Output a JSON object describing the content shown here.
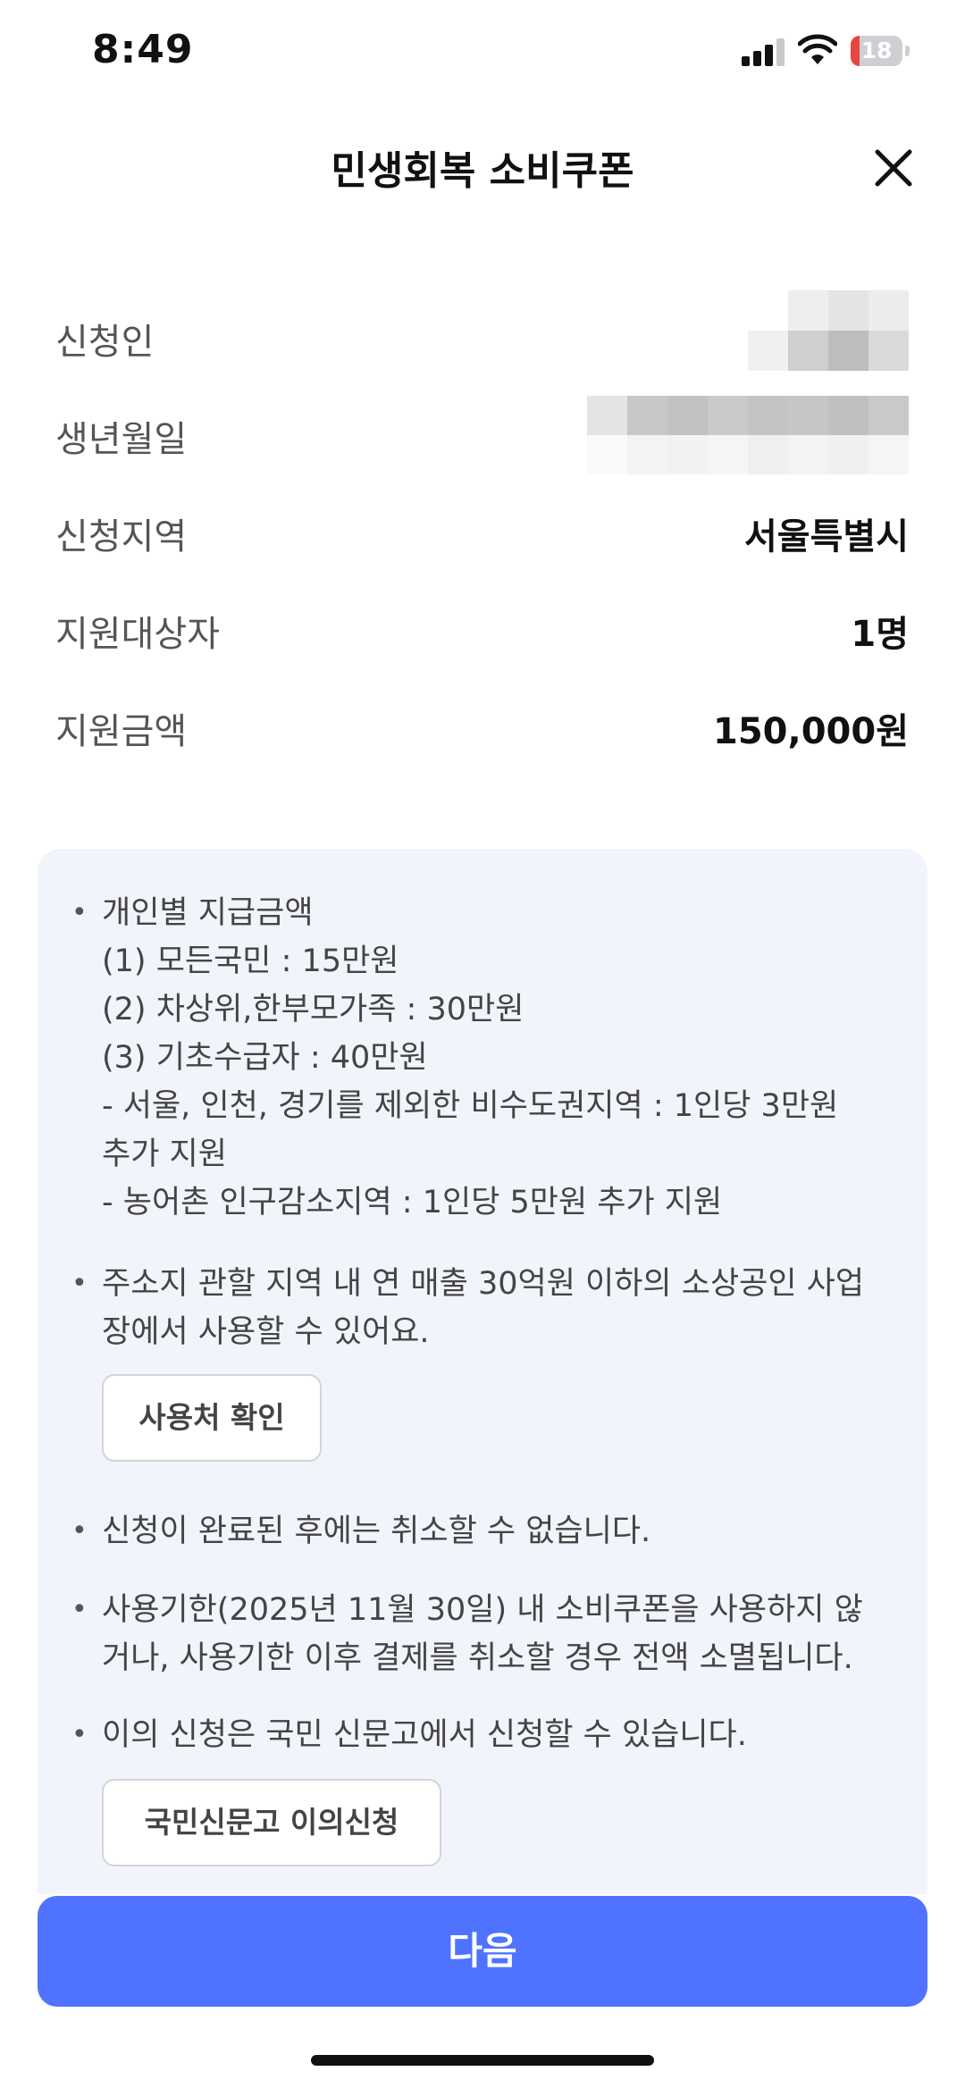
{
  "status_bar": {
    "time": "8:49",
    "battery_level": "18",
    "battery_fraction": 0.18,
    "battery_color": "#e5463f"
  },
  "header": {
    "title": "민생회복 소비쿠폰",
    "close_icon": "close-icon"
  },
  "info_rows": [
    {
      "label": "신청인",
      "value": null,
      "redacted": true
    },
    {
      "label": "생년월일",
      "value": null,
      "redacted": true
    },
    {
      "label": "신청지역",
      "value": "서울특별시"
    },
    {
      "label": "지원대상자",
      "value": "1명"
    },
    {
      "label": "지원금액",
      "value": "150,000원"
    }
  ],
  "notice": {
    "items": [
      {
        "lines": [
          "개인별 지급금액",
          "(1) 모든국민 : 15만원",
          "(2) 차상위,한부모가족 : 30만원",
          "(3) 기초수급자 : 40만원",
          "- 서울, 인천, 경기를 제외한 비수도권지역 : 1인당 3만원",
          "추가 지원",
          "- 농어촌 인구감소지역 : 1인당 5만원 추가 지원"
        ]
      },
      {
        "lines": [
          "주소지 관할 지역 내 연 매출 30억원 이하의 소상공인 사업",
          "장에서 사용할 수 있어요."
        ],
        "button_label": "사용처 확인"
      },
      {
        "lines": [
          "신청이 완료된 후에는 취소할 수 없습니다."
        ]
      },
      {
        "lines": [
          "사용기한(2025년 11월 30일) 내 소비쿠폰을 사용하지 않",
          "거나, 사용기한 이후 결제를 취소할 경우 전액 소멸됩니다."
        ]
      },
      {
        "lines": [
          "이의 신청은 국민 신문고에서 신청할 수 있습니다."
        ],
        "button_label": "국민신문고 이의신청"
      }
    ]
  },
  "footer": {
    "next_label": "다음"
  },
  "colors": {
    "accent": "#4f73ff",
    "panel": "#f2f4fc"
  }
}
